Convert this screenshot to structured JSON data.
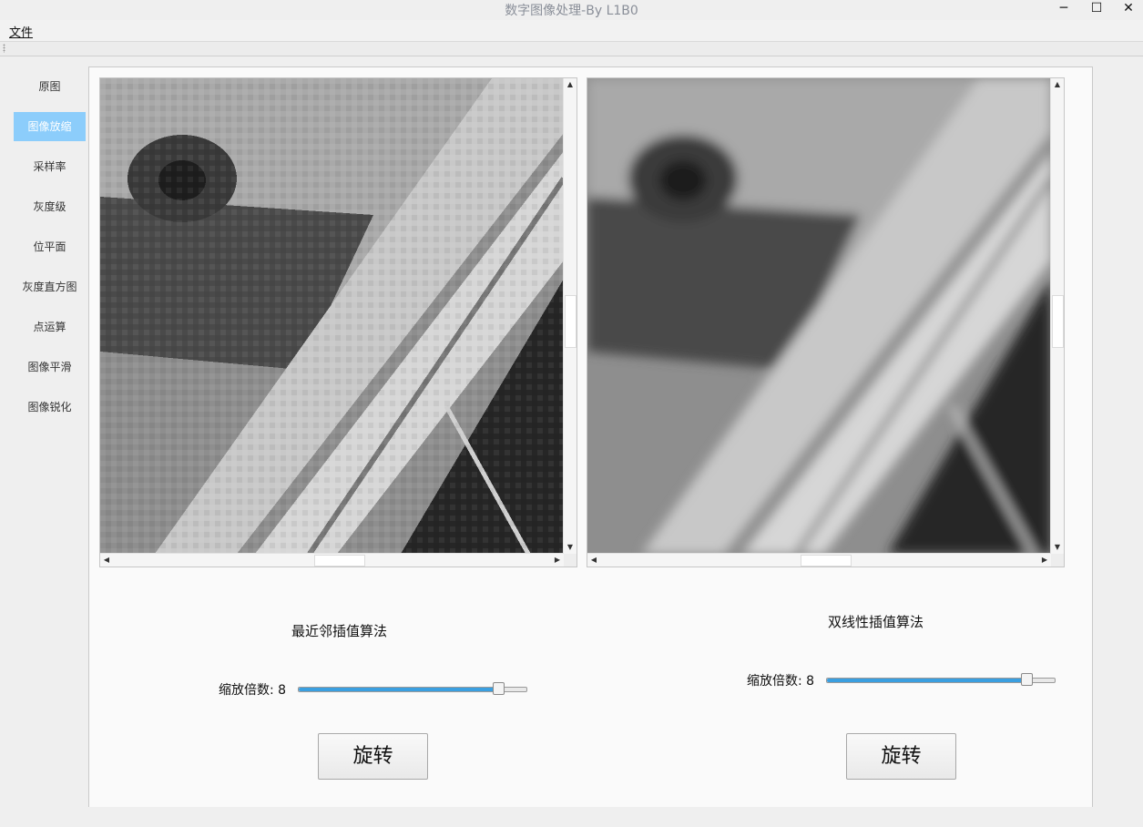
{
  "window": {
    "title": "数字图像处理-By L1B0",
    "minimize": "─",
    "maximize": "☐",
    "close": "✕"
  },
  "menu": {
    "file": "文件"
  },
  "sidebar": {
    "items": [
      {
        "label": "原图",
        "active": false
      },
      {
        "label": "图像放缩",
        "active": true
      },
      {
        "label": "采样率",
        "active": false
      },
      {
        "label": "灰度级",
        "active": false
      },
      {
        "label": "位平面",
        "active": false
      },
      {
        "label": "灰度直方图",
        "active": false
      },
      {
        "label": "点运算",
        "active": false
      },
      {
        "label": "图像平滑",
        "active": false
      },
      {
        "label": "图像锐化",
        "active": false
      }
    ]
  },
  "left_panel": {
    "algorithm": "最近邻插值算法",
    "zoom_label": "缩放倍数: 8",
    "zoom_value": 8,
    "slider_fraction": 0.88,
    "rotate": "旋转"
  },
  "right_panel": {
    "algorithm": "双线性插值算法",
    "zoom_label": "缩放倍数: 8",
    "zoom_value": 8,
    "slider_fraction": 0.88,
    "rotate": "旋转"
  },
  "colors": {
    "accent": "#8ccdfb",
    "slider_fill": "#3a9fe0"
  }
}
